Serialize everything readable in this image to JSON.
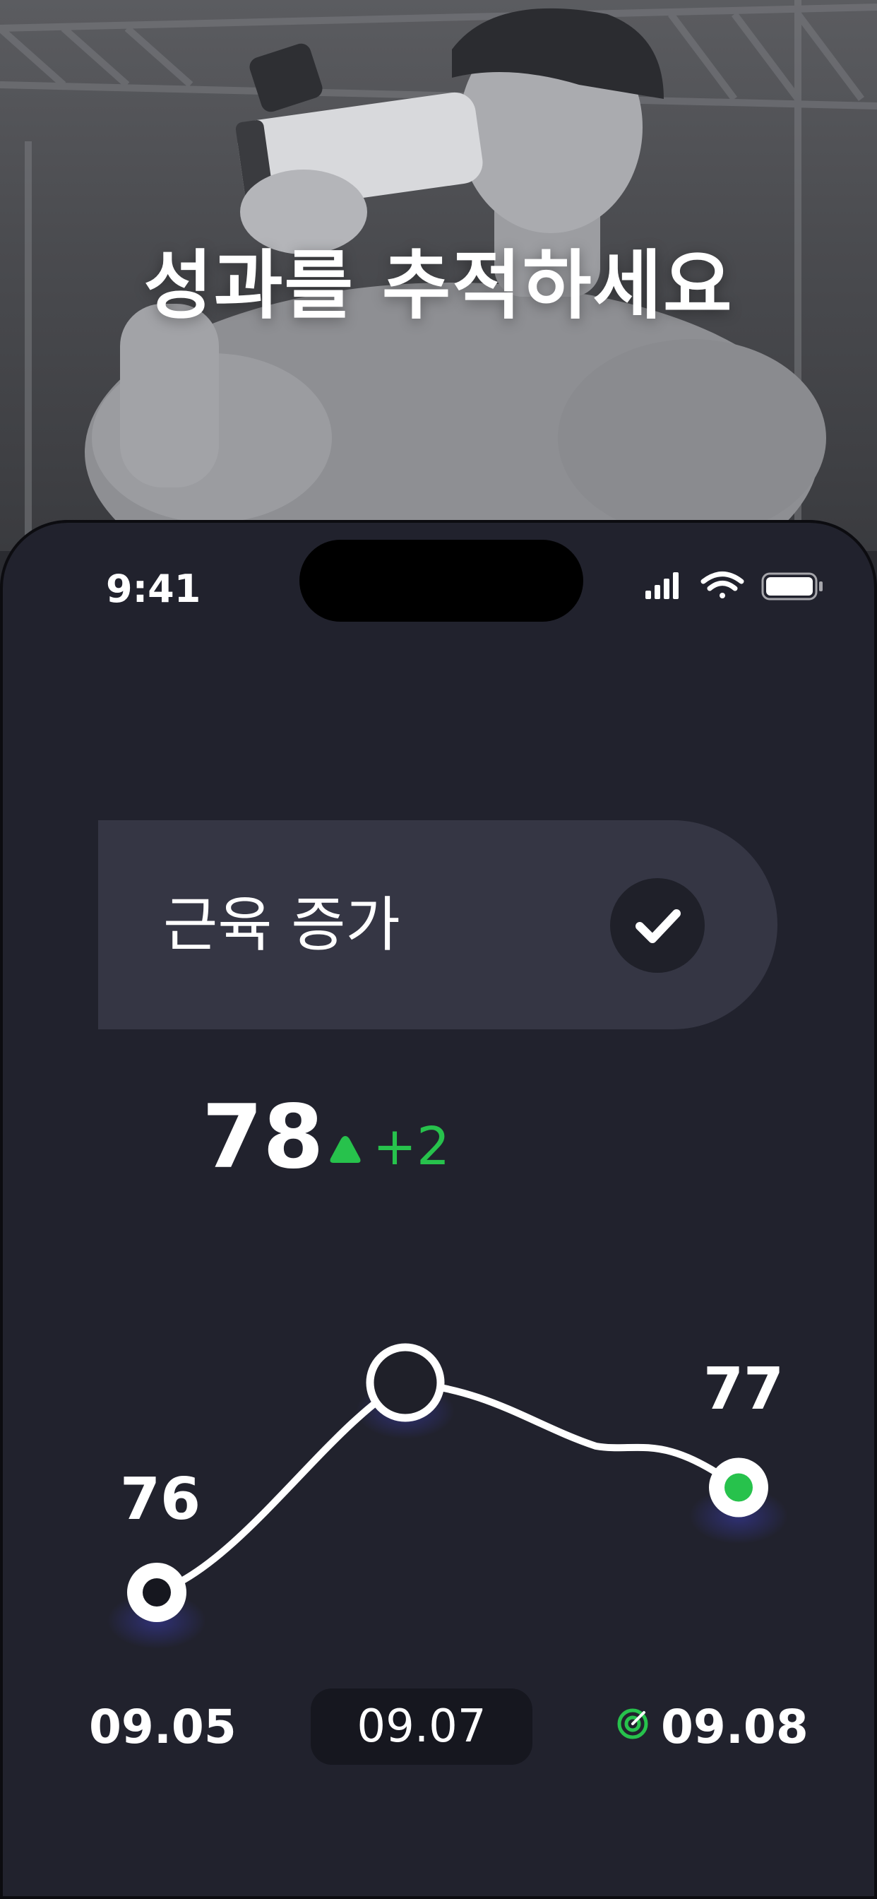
{
  "hero": {
    "title": "성과를 추적하세요"
  },
  "status_bar": {
    "time": "9:41",
    "icons": [
      "cellular-signal-icon",
      "wifi-icon",
      "battery-icon"
    ]
  },
  "goal": {
    "label": "근육 증가",
    "icon": "checkmark-icon",
    "selected": true
  },
  "progress": {
    "current_value": "78",
    "delta": "+2",
    "delta_color": "#27c24c"
  },
  "chart_data": {
    "type": "line",
    "x": [
      "09.05",
      "09.07",
      "09.08"
    ],
    "values": [
      76,
      78,
      77
    ],
    "point_labels": [
      "76",
      "",
      "77"
    ],
    "highlighted_date": "09.07",
    "target_date": "09.08",
    "line_color": "#ffffff",
    "target_color": "#27c24c",
    "grid": false
  },
  "colors": {
    "background": "#21222d",
    "card": "#353644",
    "accent_green": "#27c24c"
  }
}
